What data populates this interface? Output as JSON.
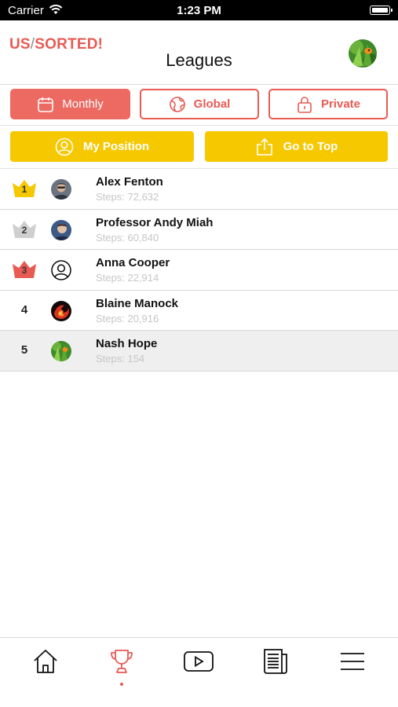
{
  "status_bar": {
    "carrier": "Carrier",
    "time": "1:23 PM"
  },
  "header": {
    "logo_part_a": "US",
    "logo_slash": "/",
    "logo_part_b": "SORTED!",
    "title": "Leagues"
  },
  "tabs": [
    {
      "label": "Monthly",
      "icon": "calendar-icon",
      "active": true
    },
    {
      "label": "Global",
      "icon": "globe-icon",
      "active": false
    },
    {
      "label": "Private",
      "icon": "lock-icon",
      "active": false
    }
  ],
  "actions": {
    "my_position": "My Position",
    "go_to_top": "Go to Top"
  },
  "leaderboard": [
    {
      "rank": "1",
      "name": "Alex Fenton",
      "steps": "Steps: 72,632",
      "badge": "gold-crown"
    },
    {
      "rank": "2",
      "name": "Professor Andy Miah",
      "steps": "Steps: 60,840",
      "badge": "silver-crown"
    },
    {
      "rank": "3",
      "name": "Anna Cooper",
      "steps": "Steps: 22,914",
      "badge": "bronze-crown"
    },
    {
      "rank": "4",
      "name": "Blaine Manock",
      "steps": "Steps: 20,916",
      "badge": "none"
    },
    {
      "rank": "5",
      "name": "Nash Hope",
      "steps": "Steps: 154",
      "badge": "none"
    }
  ],
  "colors": {
    "brand_red": "#e85a52",
    "active_tab": "#ec6a62",
    "action_yellow": "#f5c800",
    "gold": "#f5c800",
    "silver": "#cfcfcf",
    "bronze": "#e85a52",
    "highlight_row": "#efefef"
  },
  "bottom_nav": [
    {
      "icon": "home-icon"
    },
    {
      "icon": "trophy-icon",
      "active": true
    },
    {
      "icon": "video-play-icon"
    },
    {
      "icon": "newspaper-icon"
    },
    {
      "icon": "hamburger-menu-icon"
    }
  ]
}
